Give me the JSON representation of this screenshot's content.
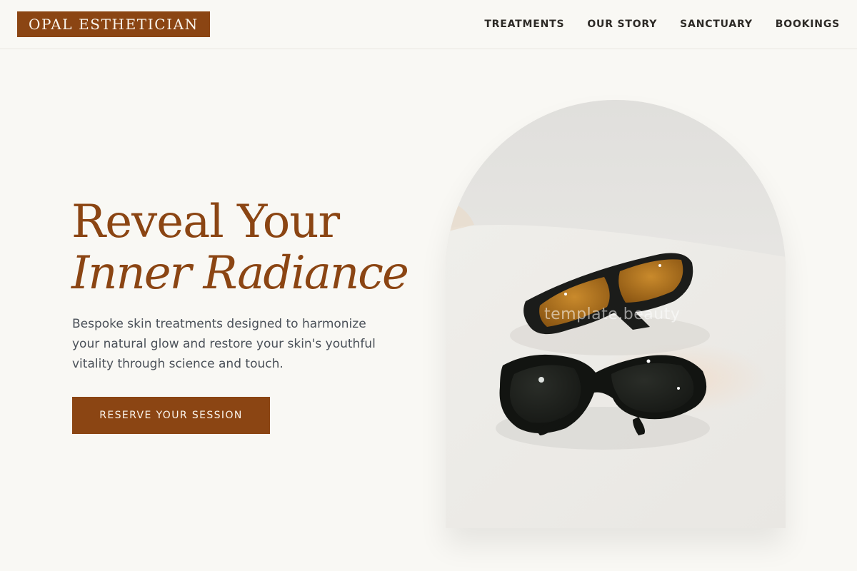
{
  "brand": {
    "name": "OPAL ESTHETICIAN"
  },
  "nav": {
    "items": [
      {
        "label": "TREATMENTS"
      },
      {
        "label": "OUR STORY"
      },
      {
        "label": "SANCTUARY"
      },
      {
        "label": "BOOKINGS"
      }
    ]
  },
  "hero": {
    "title_line1": "Reveal Your",
    "title_line2": "Inner Radiance",
    "subtitle": "Bespoke skin treatments designed to harmonize your natural glow and restore your skin's youthful vitality through science and touch.",
    "cta_label": "RESERVE YOUR SESSION",
    "image_watermark": "template.beauty"
  },
  "colors": {
    "accent": "#8b4513",
    "background": "#f9f8f4",
    "text_dark": "#2d2a26",
    "text_muted": "#4a5058"
  }
}
